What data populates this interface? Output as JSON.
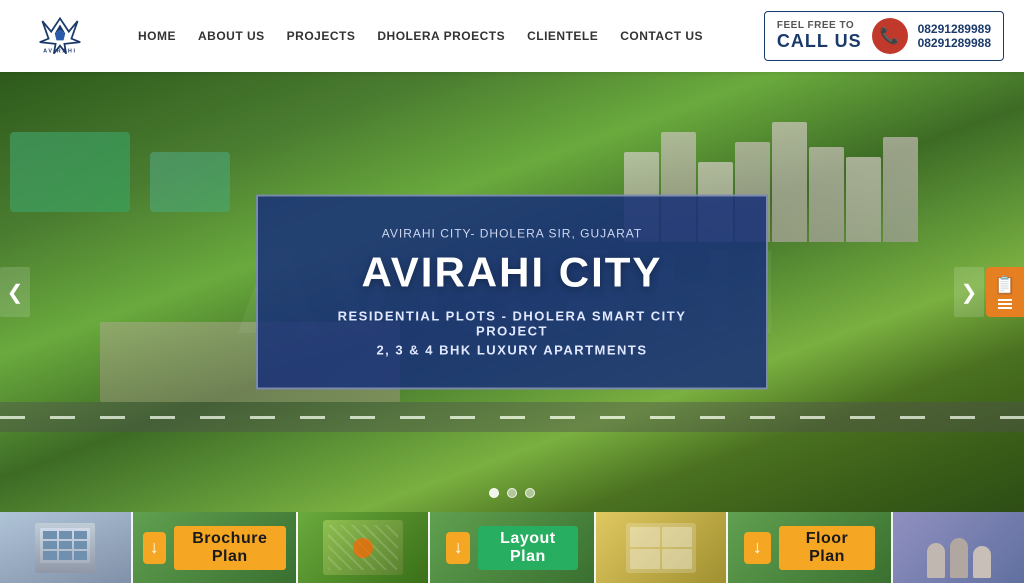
{
  "header": {
    "logo_text": "AVIRAHI",
    "nav_items": [
      {
        "label": "HOME",
        "id": "home"
      },
      {
        "label": "ABOUT US",
        "id": "about"
      },
      {
        "label": "PROJECTS",
        "id": "projects"
      },
      {
        "label": "DHOLERA PROECTS",
        "id": "dholera"
      },
      {
        "label": "CLIENTELE",
        "id": "clientele"
      },
      {
        "label": "CONTACT US",
        "id": "contact"
      }
    ],
    "call_box": {
      "feel_free": "FEEL FREE TO",
      "call_us": "CALL US",
      "phone1": "08291289989",
      "phone2": "08291289988"
    }
  },
  "hero": {
    "subtitle": "AVIRAHI CITY- DHOLERA SIR, GUJARAT",
    "title": "AVIRAHI CITY",
    "line1": "RESIDENTIAL PLOTS - DHOLERA SMART CITY PROJECT",
    "line2": "2, 3 & 4 BHK LUXURY APARTMENTS",
    "dots": [
      {
        "active": true
      },
      {
        "active": false
      },
      {
        "active": false
      }
    ],
    "watermark": "AVIRAHI"
  },
  "bottom_plans": [
    {
      "label": "Brochure Plan",
      "color": "orange",
      "segment_class": "seg1-bg"
    },
    {
      "label": "Layout Plan",
      "color": "green",
      "segment_class": "seg2-bg"
    },
    {
      "label": "Floor Plan",
      "color": "orange",
      "segment_class": "seg3-bg"
    }
  ],
  "icons": {
    "phone": "📞",
    "download": "↓",
    "arrow_left": "❮",
    "arrow_right": "❯",
    "doc": "📋"
  }
}
